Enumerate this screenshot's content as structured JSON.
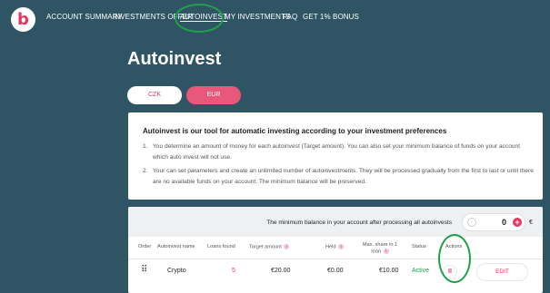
{
  "nav": {
    "logo_letter": "b",
    "items": [
      "ACCOUNT SUMMARY",
      "INVESTMENTS OFFER",
      "AUTOINVEST",
      "MY INVESTMENTS",
      "FAQ",
      "GET 1% BONUS"
    ],
    "active": "AUTOINVEST"
  },
  "page": {
    "title": "Autoinvest"
  },
  "currency": {
    "czk": "CZK",
    "eur": "EUR",
    "selected": "EUR"
  },
  "info": {
    "heading": "Autoinvest is our tool for automatic investing according to your investment preferences",
    "points": [
      {
        "num": "1.",
        "text": "You determine an amount of money for each autoinvest (Target amount). You can also set your minimum balance of funds on your account which auto invest will not use."
      },
      {
        "num": "2.",
        "text": "Your can set parameters and create an unlimited number of autoinvestments. They will be processed gradually from the first to last or until there are no available funds on your account. The minimum balance will be preserved."
      }
    ]
  },
  "min_balance": {
    "label": "The minimum balance in your account after processing all autoinvests",
    "minus_symbol": "-",
    "value": "0",
    "plus_symbol": "+",
    "currency": "€"
  },
  "table": {
    "headers": {
      "order": "Order",
      "name": "Autoinvest name",
      "loans": "Loans found",
      "target": "Target amount",
      "held": "Held",
      "max_share_line1": "Max. share in 1",
      "max_share_line2": "loan",
      "status": "Status",
      "actions": "Actions"
    },
    "info_symbol": "i",
    "row": {
      "drag_symbol": "⠿",
      "name": "Crypto",
      "loans": "5",
      "target": "€20.00",
      "held": "€0.00",
      "max_share": "€10.00",
      "status": "Active",
      "pause_symbol": "II",
      "edit_label": "EDIT"
    }
  },
  "colors": {
    "background": "#2f5464",
    "accent": "#e8355f",
    "highlight_circle": "#1fa04a",
    "active_status": "#1fa04a"
  }
}
